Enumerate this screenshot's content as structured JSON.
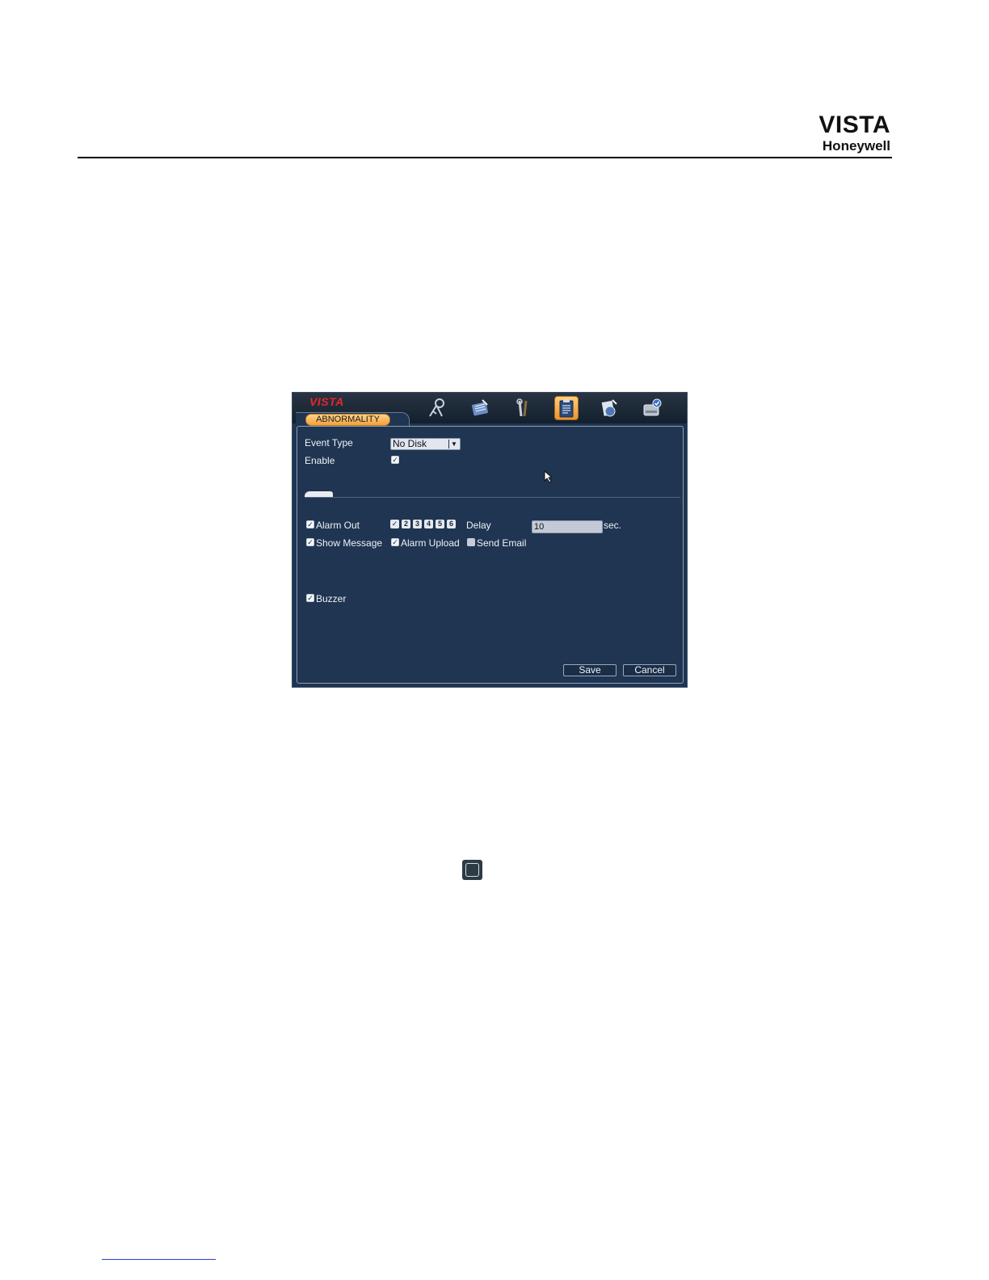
{
  "page": {
    "brand_title": "VISTA",
    "brand_subtitle": "Honeywell"
  },
  "dvr": {
    "logo": "VISTA",
    "tab_label": "ABNORMALITY",
    "toolbar_icons": [
      "network-icon",
      "record-icon",
      "tools-icon",
      "event-icon",
      "backup-icon",
      "disk-icon"
    ],
    "active_icon": "event-icon",
    "event_type_label": "Event Type",
    "event_type_value": "No Disk",
    "enable_label": "Enable",
    "enable_checked": true,
    "alarm_out_label": "Alarm Out",
    "alarm_out_channels": [
      "✓",
      "2",
      "3",
      "4",
      "5",
      "6"
    ],
    "delay_label": "Delay",
    "delay_value": "10",
    "delay_unit": "sec.",
    "show_message_label": "Show Message",
    "alarm_upload_label": "Alarm Upload",
    "send_email_label": "Send Email",
    "buzzer_label": "Buzzer",
    "save_label": "Save",
    "cancel_label": "Cancel",
    "checkbox_glyph": "✓"
  },
  "colors": {
    "panel_bg": "#1f3552",
    "accent_orange": "#f2a23b",
    "logo_red": "#e4262b"
  }
}
